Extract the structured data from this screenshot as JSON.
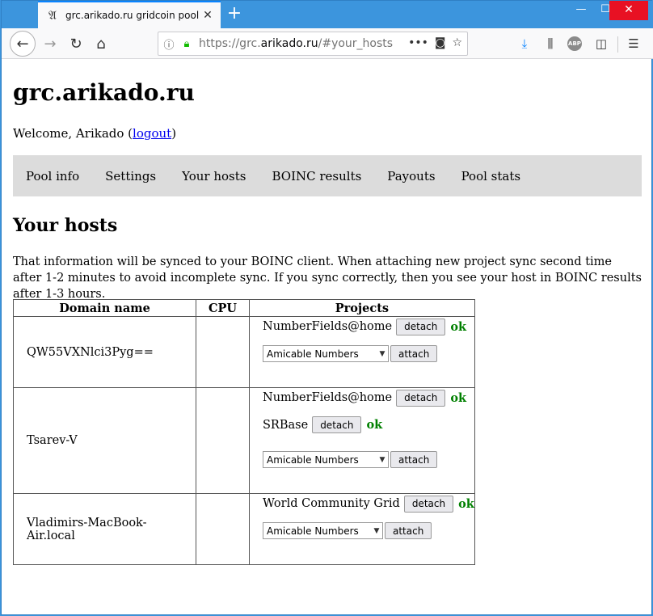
{
  "browser": {
    "tab_title": "grc.arikado.ru gridcoin pool",
    "tab_favicon": "𝔄",
    "url_scheme": "https://grc.",
    "url_host": "arikado.ru",
    "url_path": "/#your_hosts"
  },
  "page": {
    "site_title": "grc.arikado.ru",
    "welcome_prefix": "Welcome, Arikado (",
    "logout_label": "logout",
    "welcome_suffix": ")",
    "menu": [
      "Pool info",
      "Settings",
      "Your hosts",
      "BOINC results",
      "Payouts",
      "Pool stats"
    ],
    "section_title": "Your hosts",
    "intro": "That information will be synced to your BOINC client. When attaching new project sync second time after 1-2 minutes to avoid incomplete sync. If you sync correctly, then you see your host in BOINC results after 1-3 hours.",
    "table_headers": {
      "domain": "Domain name",
      "cpu": "CPU",
      "projects": "Projects"
    },
    "hosts": [
      {
        "domain": "QW55VXNlci3Pyg==",
        "cpu": "",
        "projects": [
          {
            "name": "NumberFields@home",
            "action": "detach",
            "status": "ok"
          }
        ],
        "select_value": "Amicable Numbers",
        "attach_label": "attach"
      },
      {
        "domain": "Tsarev-V",
        "cpu": "",
        "projects": [
          {
            "name": "NumberFields@home",
            "action": "detach",
            "status": "ok"
          },
          {
            "name": "SRBase",
            "action": "detach",
            "status": "ok"
          }
        ],
        "select_value": "Amicable Numbers",
        "attach_label": "attach"
      },
      {
        "domain": "Vladimirs-MacBook-Air.local",
        "cpu": "",
        "projects": [
          {
            "name": "World Community Grid",
            "action": "detach",
            "status": "ok"
          }
        ],
        "select_value": "Amicable Numbers",
        "attach_label": "attach"
      }
    ]
  },
  "colors": {
    "ok": "#008000",
    "menu_bg": "#dcdcdc",
    "link": "#0000ee",
    "titlebar": "#3c95dd"
  }
}
